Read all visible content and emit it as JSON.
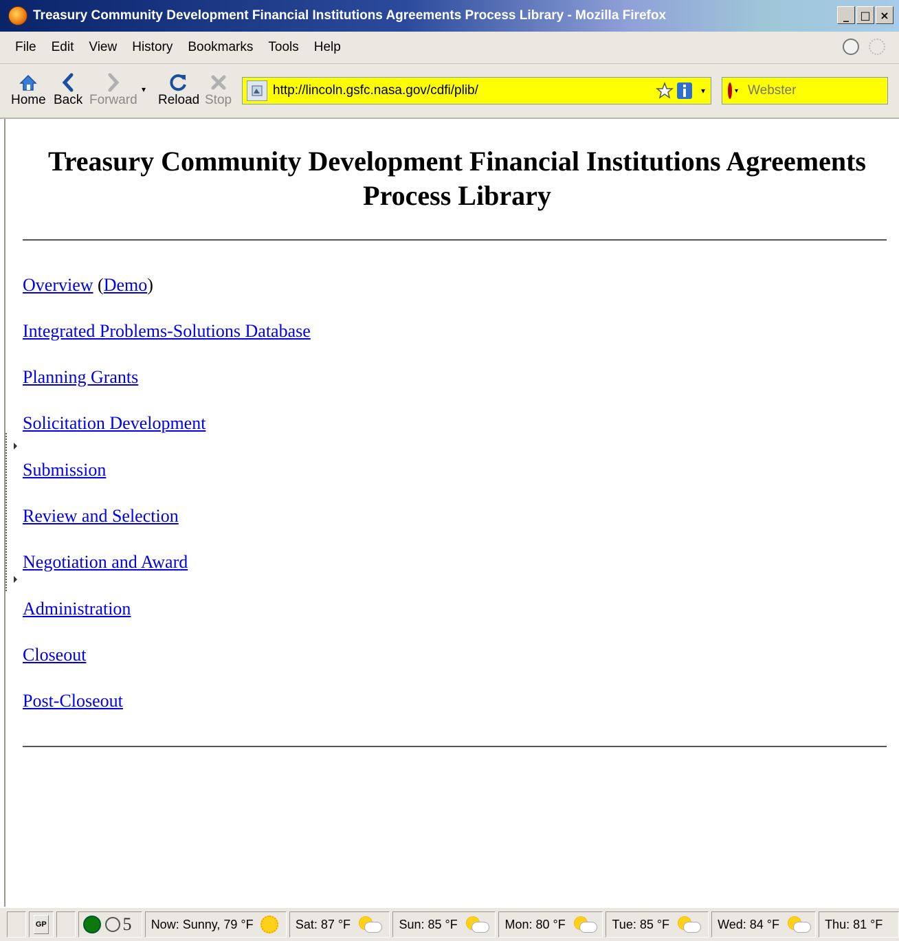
{
  "window": {
    "title": "Treasury Community Development Financial Institutions Agreements Process Library - Mozilla Firefox",
    "buttons": {
      "minimize": "_",
      "maximize": "□",
      "close": "×"
    }
  },
  "menubar": {
    "items": [
      {
        "label": "File"
      },
      {
        "label": "Edit"
      },
      {
        "label": "View"
      },
      {
        "label": "History"
      },
      {
        "label": "Bookmarks"
      },
      {
        "label": "Tools"
      },
      {
        "label": "Help"
      }
    ]
  },
  "toolbar": {
    "home_label": "Home",
    "back_label": "Back",
    "forward_label": "Forward",
    "reload_label": "Reload",
    "stop_label": "Stop",
    "url": "http://lincoln.gsfc.nasa.gov/cdfi/plib/",
    "search_placeholder": "Webster"
  },
  "page": {
    "title": "Treasury Community Development Financial Institutions Agreements Process Library",
    "links": [
      {
        "label": "Overview"
      },
      {
        "label": "Demo"
      },
      {
        "label": "Integrated Problems-Solutions Database"
      },
      {
        "label": "Planning Grants"
      },
      {
        "label": "Solicitation Development"
      },
      {
        "label": "Submission"
      },
      {
        "label": "Review and Selection"
      },
      {
        "label": "Negotiation and Award"
      },
      {
        "label": "Administration"
      },
      {
        "label": "Closeout"
      },
      {
        "label": "Post-Closeout"
      }
    ],
    "paren_open": "(",
    "paren_close": ")"
  },
  "statusbar": {
    "gp_label": "GP",
    "count": "5",
    "weather": [
      {
        "label": "Now: Sunny, 79 °F",
        "icon": "sun-icon"
      },
      {
        "label": "Sat: 87 °F",
        "icon": "partly-cloudy-icon"
      },
      {
        "label": "Sun: 85 °F",
        "icon": "partly-cloudy-icon"
      },
      {
        "label": "Mon: 80 °F",
        "icon": "partly-cloudy-icon"
      },
      {
        "label": "Tue: 85 °F",
        "icon": "partly-cloudy-icon"
      },
      {
        "label": "Wed: 84 °F",
        "icon": "partly-cloudy-icon"
      },
      {
        "label": "Thu: 81 °F",
        "icon": "partly-cloudy-icon"
      }
    ]
  }
}
